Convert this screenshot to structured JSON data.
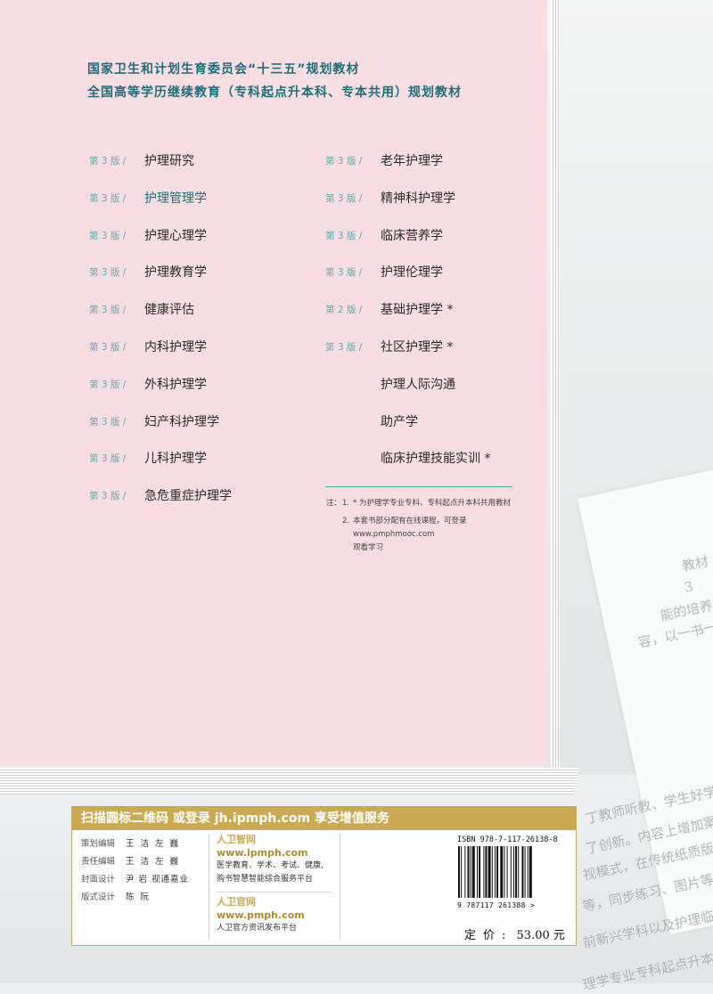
{
  "header": {
    "line1": "国家卫生和计划生育委员会“十三五”规划教材",
    "line2": "全国高等学历继续教育（专科起点升本科、专本共用）规划教材"
  },
  "books_left": [
    {
      "edition": "第 3 版 /",
      "title": "护理研究"
    },
    {
      "edition": "第 3 版 /",
      "title": "护理管理学"
    },
    {
      "edition": "第 3 版 /",
      "title": "护理心理学"
    },
    {
      "edition": "第 3 版 /",
      "title": "护理教育学"
    },
    {
      "edition": "第 3 版 /",
      "title": "健康评估"
    },
    {
      "edition": "第 3 版 /",
      "title": "内科护理学"
    },
    {
      "edition": "第 3 版 /",
      "title": "外科护理学"
    },
    {
      "edition": "第 3 版 /",
      "title": "妇产科护理学"
    },
    {
      "edition": "第 3 版 /",
      "title": "儿科护理学"
    },
    {
      "edition": "第 3 版 /",
      "title": "急危重症护理学"
    }
  ],
  "books_right": [
    {
      "edition": "第 3 版 /",
      "title": "老年护理学"
    },
    {
      "edition": "第 3 版 /",
      "title": "精神科护理学"
    },
    {
      "edition": "第 3 版 /",
      "title": "临床营养学"
    },
    {
      "edition": "第 3 版 /",
      "title": "护理伦理学"
    },
    {
      "edition": "第 2 版 /",
      "title": "基础护理学 *"
    },
    {
      "edition": "第 3 版 /",
      "title": "社区护理学 *"
    },
    {
      "edition": "",
      "title": "护理人际沟通"
    },
    {
      "edition": "",
      "title": "助产学"
    },
    {
      "edition": "",
      "title": "临床护理技能实训 *"
    }
  ],
  "notes": {
    "label": "注：",
    "item1_num": "1.",
    "item1": "* 为护理学专业专科、专科起点升本科共用教材",
    "item2_num": "2.",
    "item2_line1": "本套书部分配有在线课程，可登录 www.pmphmooc.com",
    "item2_line2": "观看学习"
  },
  "info": {
    "banner": "扫描圆标二维码 或登录 jh.ipmph.com 享受增值服务",
    "credits": [
      {
        "role": "策划编辑",
        "name": "王 洁 左 巍"
      },
      {
        "role": "责任编辑",
        "name": "王 洁 左 巍"
      },
      {
        "role": "封面设计",
        "name": "尹 岩 视通嘉业"
      },
      {
        "role": "版式设计",
        "name": "陈 阮"
      }
    ],
    "service1_title": "人卫智网",
    "service1_url": "www.ipmph.com",
    "service1_desc1": "医学教育、学术、考试、健康,",
    "service1_desc2": "购书智慧智能综合服务平台",
    "service2_title": "人卫官网",
    "service2_url": "www.pmph.com",
    "service2_desc": "人卫官方资讯发布平台",
    "isbn": "ISBN  978-7-117-26138-8",
    "barcode_digits": "9 787117 261388 >",
    "price_label": "定价:",
    "price_value": "53.00 元"
  },
  "background_text": [
    "教材",
    "3",
    "能的培养。",
    "容，以一书一码",
    "丁教师听教、学生好学、实",
    "了创新。内容上增加案例及解",
    "视模式，在传统纸质版教材的",
    "等，同步练习、图片等。",
    "前新兴学科以及护理临床操作",
    "理学专业专科起点升本科（普"
  ],
  "colors": {
    "panel": "#f8dde3",
    "teal": "#1f6e78",
    "edition_teal": "#5fa8ad",
    "gold": "#c9a951"
  }
}
